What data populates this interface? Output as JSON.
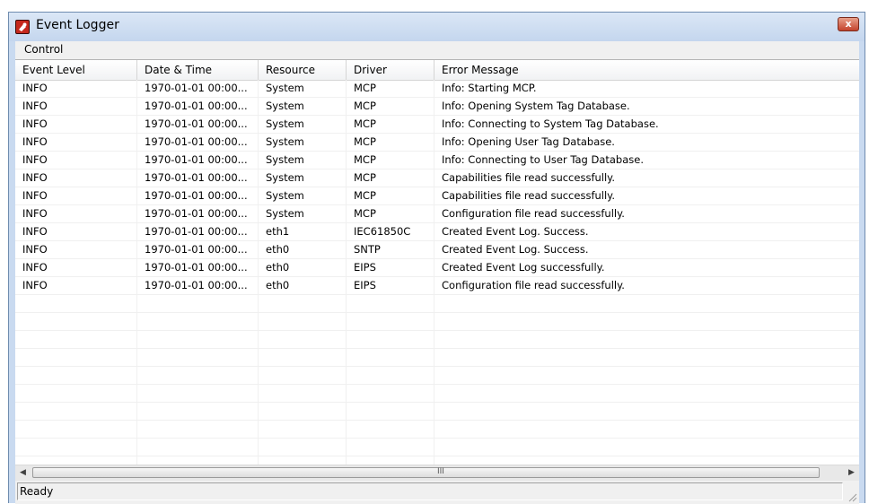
{
  "window": {
    "title": "Event Logger",
    "close_label": "x"
  },
  "menu": {
    "items": [
      "Control"
    ]
  },
  "table": {
    "columns": [
      "Event Level",
      "Date & Time",
      "Resource",
      "Driver",
      "Error Message"
    ],
    "rows": [
      [
        "INFO",
        "1970-01-01 00:00...",
        "System",
        "MCP",
        "Info: Starting MCP."
      ],
      [
        "INFO",
        "1970-01-01 00:00...",
        "System",
        "MCP",
        "Info: Opening System Tag Database."
      ],
      [
        "INFO",
        "1970-01-01 00:00...",
        "System",
        "MCP",
        "Info: Connecting to System Tag Database."
      ],
      [
        "INFO",
        "1970-01-01 00:00...",
        "System",
        "MCP",
        "Info: Opening User Tag Database."
      ],
      [
        "INFO",
        "1970-01-01 00:00...",
        "System",
        "MCP",
        "Info: Connecting to User Tag Database."
      ],
      [
        "INFO",
        "1970-01-01 00:00...",
        "System",
        "MCP",
        "Capabilities file read successfully."
      ],
      [
        "INFO",
        "1970-01-01 00:00...",
        "System",
        "MCP",
        "Capabilities file read successfully."
      ],
      [
        "INFO",
        "1970-01-01 00:00...",
        "System",
        "MCP",
        "Configuration file read successfully."
      ],
      [
        "INFO",
        "1970-01-01 00:00...",
        "eth1",
        "IEC61850C",
        "Created Event Log. Success."
      ],
      [
        "INFO",
        "1970-01-01 00:00...",
        "eth0",
        "SNTP",
        "Created Event Log. Success."
      ],
      [
        "INFO",
        "1970-01-01 00:00...",
        "eth0",
        "EIPS",
        "Created Event Log successfully."
      ],
      [
        "INFO",
        "1970-01-01 00:00...",
        "eth0",
        "EIPS",
        "Configuration file read successfully."
      ]
    ]
  },
  "scrollbar": {
    "left_arrow": "◀",
    "right_arrow": "▶",
    "grip": "III"
  },
  "status": {
    "text": "Ready"
  }
}
